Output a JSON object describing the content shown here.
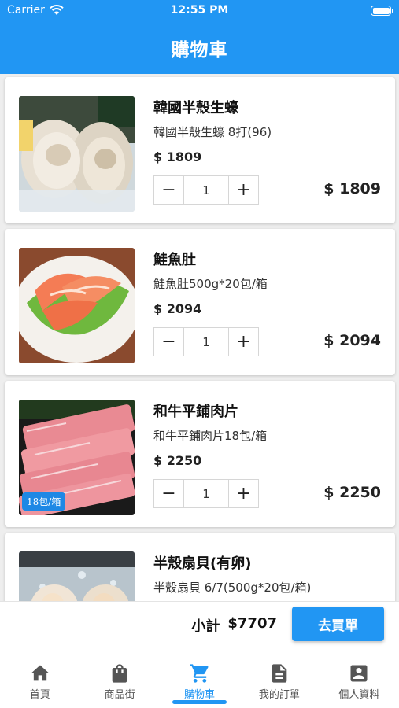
{
  "status_bar": {
    "carrier": "Carrier",
    "time": "12:55 PM"
  },
  "app_bar": {
    "title": "購物車"
  },
  "cart_items": [
    {
      "name": "韓國半殼生蠔",
      "spec": "韓國半殼生蠔  8打(96)",
      "price": "$ 1809",
      "quantity": "1",
      "total": "$ 1809",
      "image": "oyster-photo"
    },
    {
      "name": "鮭魚肚",
      "spec": "鮭魚肚500g*20包/箱",
      "price": "$ 2094",
      "quantity": "1",
      "total": "$ 2094",
      "image": "salmon-belly-photo"
    },
    {
      "name": "和牛平鋪肉片",
      "spec": "和牛平鋪肉片18包/箱",
      "price": "$ 2250",
      "quantity": "1",
      "total": "$ 2250",
      "image": "wagyu-slices-photo",
      "badge": "18包/箱"
    },
    {
      "name": "半殼扇貝(有卵)",
      "spec": "半殼扇貝 6/7(500g*20包/箱)",
      "image": "scallop-photo"
    }
  ],
  "checkout": {
    "subtotal_label": "小計",
    "subtotal_value": "$7707",
    "buy_label": "去買單"
  },
  "tabs": [
    {
      "label": "首頁",
      "icon": "home-icon"
    },
    {
      "label": "商品街",
      "icon": "shopping-bag-icon"
    },
    {
      "label": "購物車",
      "icon": "cart-icon",
      "active": true
    },
    {
      "label": "我的訂單",
      "icon": "order-document-icon"
    },
    {
      "label": "個人資料",
      "icon": "profile-icon"
    }
  ],
  "colors": {
    "primary": "#2196f3",
    "badge": "#1e88e5"
  }
}
